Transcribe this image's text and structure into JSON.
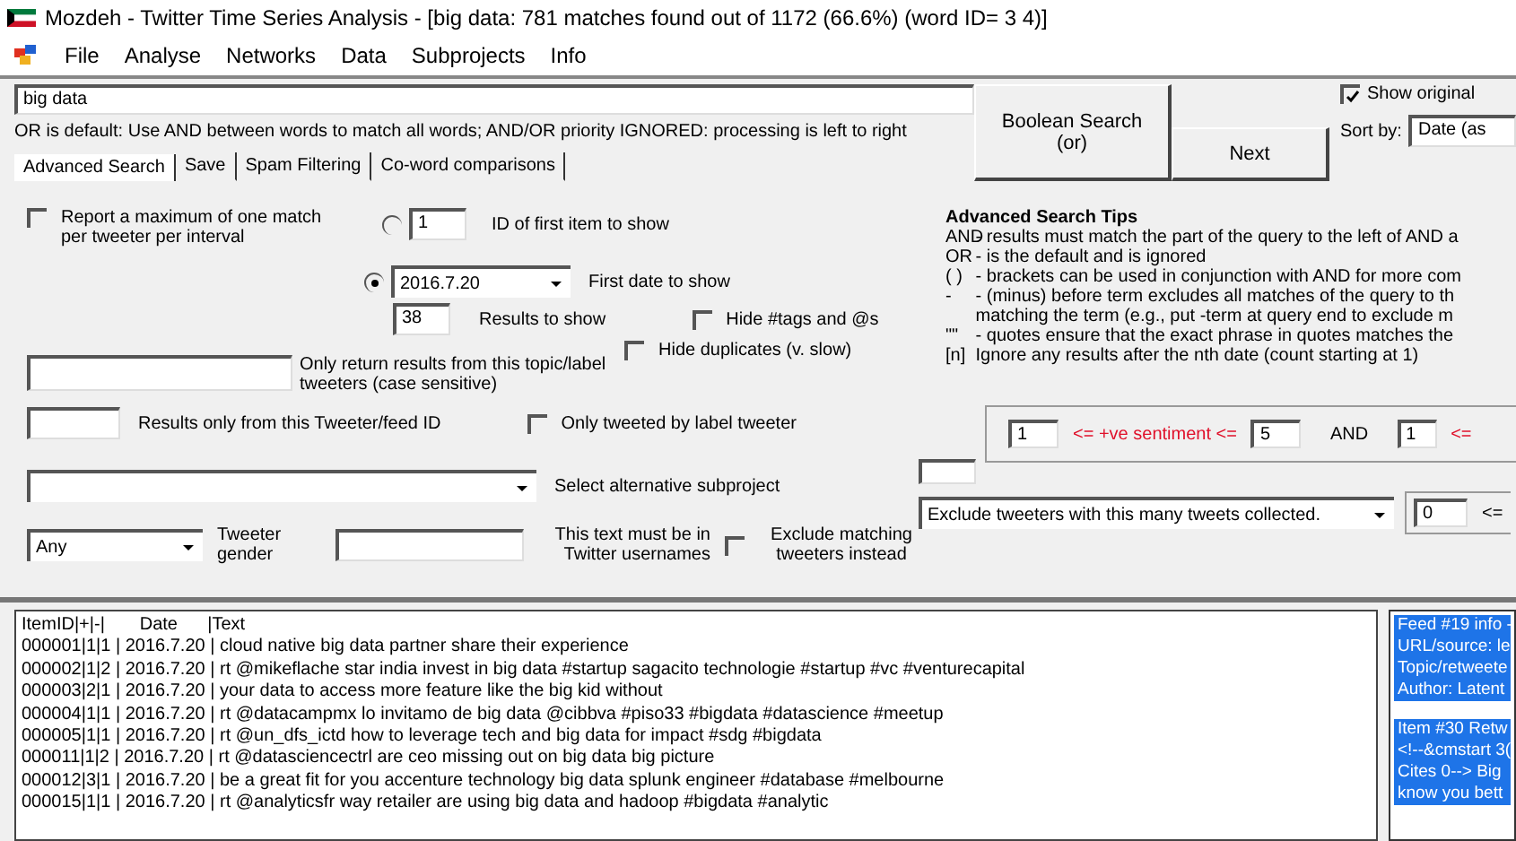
{
  "window": {
    "title": "Mozdeh - Twitter Time Series Analysis - [big data: 781 matches found out of 1172 (66.6%) (word ID= 3 4)]"
  },
  "menu": [
    "File",
    "Analyse",
    "Networks",
    "Data",
    "Subprojects",
    "Info"
  ],
  "search": {
    "value": "big data",
    "hint": "OR is default: Use AND between words to match all words; AND/OR priority IGNORED: processing is left to right"
  },
  "boolean_button": [
    "Boolean Search",
    "(or)"
  ],
  "next_button": "Next",
  "show_original": {
    "label": "Show original",
    "checked": true
  },
  "sort": {
    "label": "Sort by:",
    "value": "Date (as"
  },
  "tabs": [
    {
      "label": "Advanced Search",
      "selected": true
    },
    {
      "label": "Save",
      "selected": false
    },
    {
      "label": "Spam Filtering",
      "selected": false
    },
    {
      "label": "Co-word comparisons",
      "selected": false
    }
  ],
  "report_max": {
    "label": "Report a maximum of one match per tweeter per interval",
    "checked": false
  },
  "first_id": {
    "value": "1",
    "label": "ID of first item to show",
    "selected": false
  },
  "first_date": {
    "value": "2016.7.20",
    "label": "First date to show",
    "selected": true
  },
  "results_count": {
    "value": "38",
    "label": "Results to show"
  },
  "hide_tags": {
    "label": "Hide #tags and @s",
    "checked": false
  },
  "hide_duplicates": {
    "label": "Hide duplicates (v. slow)",
    "checked": false
  },
  "topic_label": {
    "label": "Only return results from this topic/label tweeters (case sensitive)"
  },
  "tweeter_id": {
    "label": "Results only from this Tweeter/feed ID"
  },
  "label_tweeter": {
    "label": "Only tweeted by label tweeter",
    "checked": false
  },
  "subproject": {
    "label": "Select alternative subproject"
  },
  "gender": {
    "value": "Any",
    "label": "Tweeter gender"
  },
  "username": {
    "label": "This text must be in Twitter usernames"
  },
  "exclude_matching": {
    "label": "Exclude matching tweeters instead",
    "checked": false
  },
  "tips": {
    "title": "Advanced Search Tips",
    "lines": [
      {
        "key": "AND",
        "text": "- results must match the part of the query to the left of AND a"
      },
      {
        "key": "OR",
        "text": "- is the default and is ignored"
      },
      {
        "key": "( )",
        "text": "- brackets can be used in conjunction with AND for more com"
      },
      {
        "key": "-",
        "text": "- (minus) before term excludes all matches of the query to th"
      },
      {
        "text": "matching the term (e.g., put -term at query end to exclude m"
      },
      {
        "key": "\"\"",
        "text": "- quotes ensure that the exact phrase in quotes matches the"
      },
      {
        "key": "[n]",
        "text": "Ignore any results after the nth date (count starting at 1)"
      }
    ]
  },
  "sentiment": {
    "min": "1",
    "label": "<= +ve sentiment <=",
    "max": "5",
    "joiner": "AND",
    "min2": "1",
    "label2": "<="
  },
  "tweet_filter": {
    "value": "Exclude tweeters with this many tweets collected.",
    "min": "0",
    "label": "<="
  },
  "results": {
    "header": "ItemID|+|-|       Date      |Text",
    "rows": [
      "000001|1|1 | 2016.7.20 | cloud native big data partner share their experience",
      "000002|1|2 | 2016.7.20 | rt @mikeflache star india invest in big data #startup sagacito technologie #startup #vc #venturecapital",
      "000003|2|1 | 2016.7.20 | your data to access more feature like the big kid without",
      "000004|1|1 | 2016.7.20 | rt @datacampmx lo invitamo de big data @cibbva #piso33 #bigdata #datascience #meetup",
      "000005|1|1 | 2016.7.20 | rt @un_dfs_ictd how to leverage tech and big data for impact #sdg #bigdata",
      "000011|1|2 | 2016.7.20 | rt @datasciencectrl are ceo missing out on big data big picture",
      "000012|3|1 | 2016.7.20 | be a great fit for you accenture technology big data splunk engineer #database #melbourne",
      "000015|1|1 | 2016.7.20 | rt @analyticsfr way retailer are using big data and hadoop #bigdata #analytic"
    ]
  },
  "info": [
    [
      "Feed #19 info -",
      "URL/source: le",
      "Topic/retweete",
      "Author: Latent"
    ],
    [
      "Item #30 Retw",
      "<!--&cmstart 3(",
      "Cites 0--> Big",
      "know you bett"
    ]
  ]
}
